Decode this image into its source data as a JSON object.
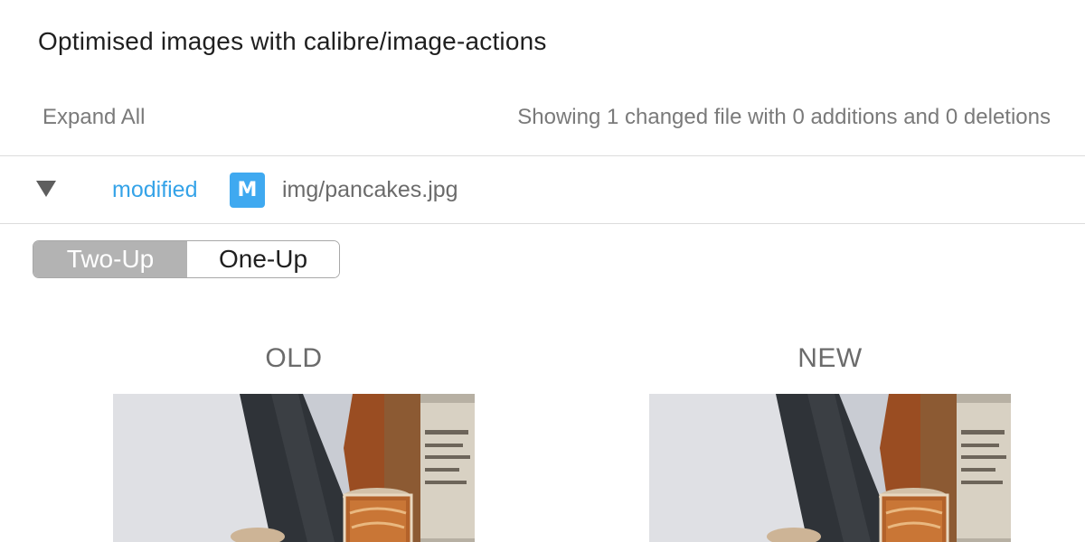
{
  "header": {
    "title": "Optimised images with calibre/image-actions"
  },
  "toolbar": {
    "expand_all_label": "Expand All",
    "summary_text": "Showing 1 changed file with 0 additions and 0 deletions"
  },
  "file": {
    "status": "modified",
    "badge": "M",
    "path": "img/pancakes.jpg",
    "expanded": true
  },
  "view_toggle": {
    "options": [
      "Two-Up",
      "One-Up"
    ],
    "selected": "Two-Up"
  },
  "comparison": {
    "old_label": "OLD",
    "new_label": "NEW"
  },
  "colors": {
    "status_modified": "#35a3e8",
    "badge_bg": "#3fa9f0",
    "toggle_active_bg": "#b3b3b3"
  },
  "icons": {
    "caret": "caret-down-icon"
  }
}
